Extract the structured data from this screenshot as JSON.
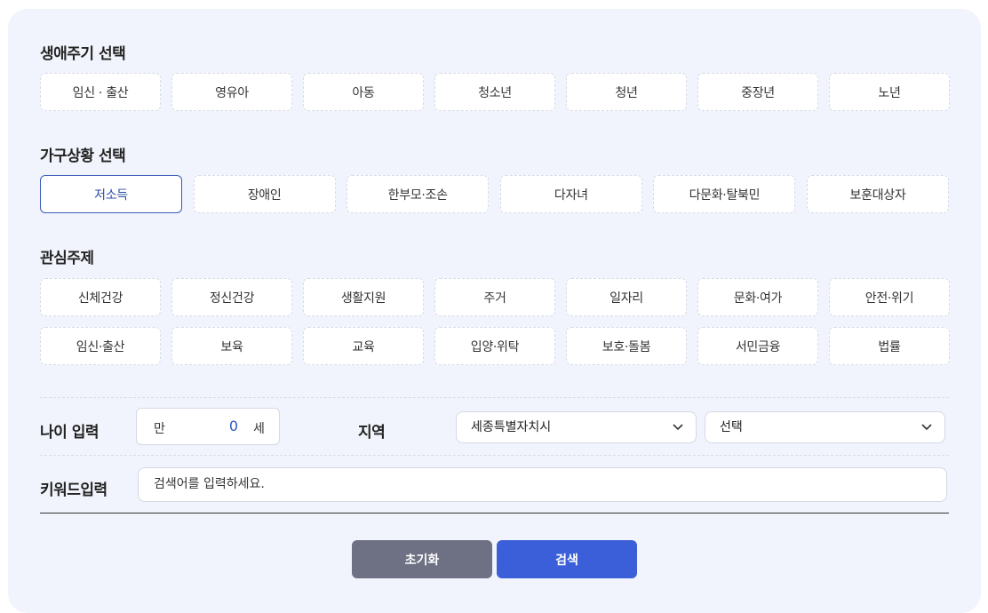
{
  "lifecycle": {
    "title": "생애주기 선택",
    "options": [
      "임신 · 출산",
      "영유아",
      "아동",
      "청소년",
      "청년",
      "중장년",
      "노년"
    ]
  },
  "household": {
    "title": "가구상황 선택",
    "options": [
      "저소득",
      "장애인",
      "한부모·조손",
      "다자녀",
      "다문화·탈북민",
      "보훈대상자"
    ],
    "selected": "저소득"
  },
  "interest": {
    "title": "관심주제",
    "row1": [
      "신체건강",
      "정신건강",
      "생활지원",
      "주거",
      "일자리",
      "문화·여가",
      "안전·위기"
    ],
    "row2": [
      "임신·출산",
      "보육",
      "교육",
      "입양·위탁",
      "보호·돌봄",
      "서민금융",
      "법률"
    ]
  },
  "age": {
    "label": "나이 입력",
    "prefix": "만",
    "value": "0",
    "suffix": "세"
  },
  "region": {
    "label": "지역",
    "province": "세종특별자치시",
    "district": "선택"
  },
  "keyword": {
    "label": "키워드입력",
    "placeholder": "검색어를 입력하세요."
  },
  "actions": {
    "reset": "초기화",
    "search": "검색"
  },
  "colors": {
    "panel_bg": "#f1f4fc",
    "accent": "#3a5fd8",
    "reset_bg": "#6e7183",
    "selected_border": "#3a5bb8"
  }
}
